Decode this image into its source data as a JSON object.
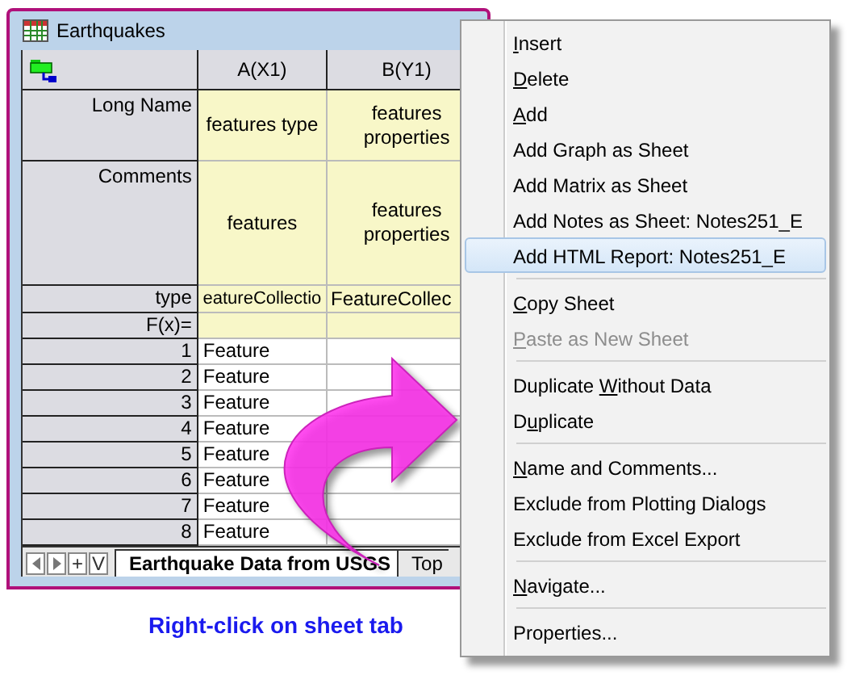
{
  "window": {
    "title": "Earthquakes"
  },
  "columns": [
    "A(X1)",
    "B(Y1)"
  ],
  "header_rows": [
    {
      "kind": "long_name",
      "label": "Long Name",
      "cells": [
        "features type",
        "features properties"
      ]
    },
    {
      "kind": "comments",
      "label": "Comments",
      "cells": [
        "features",
        "features properties"
      ]
    },
    {
      "kind": "type",
      "label": "type",
      "cells": [
        "eatureCollectio",
        "FeatureCollec"
      ]
    },
    {
      "kind": "formula",
      "label": "F(x)="
    }
  ],
  "rows": [
    {
      "index": "1",
      "cells": [
        "Feature"
      ]
    },
    {
      "index": "2",
      "cells": [
        "Feature"
      ]
    },
    {
      "index": "3",
      "cells": [
        "Feature"
      ]
    },
    {
      "index": "4",
      "cells": [
        "Feature"
      ]
    },
    {
      "index": "5",
      "cells": [
        "Feature"
      ]
    },
    {
      "index": "6",
      "cells": [
        "Feature"
      ]
    },
    {
      "index": "7",
      "cells": [
        "Feature"
      ]
    },
    {
      "index": "8",
      "cells": [
        "Feature"
      ]
    }
  ],
  "sheet_bar": {
    "buttons": [
      {
        "kind": "left"
      },
      {
        "kind": "right"
      },
      {
        "kind": "text",
        "label": "+"
      },
      {
        "kind": "text",
        "label": "V"
      }
    ],
    "tabs": [
      {
        "label": "Earthquake Data from USGS",
        "selected": true
      },
      {
        "label": "Top",
        "selected": false
      }
    ]
  },
  "caption": "Right-click on sheet tab",
  "context_menu": {
    "groups": [
      [
        {
          "access_key": "I",
          "after": "nsert",
          "selected": false,
          "disabled": false
        },
        {
          "access_key": "D",
          "after": "elete",
          "selected": false,
          "disabled": false
        },
        {
          "access_key": "A",
          "after": "dd",
          "selected": false,
          "disabled": false
        },
        {
          "before": "Add Graph as Sheet",
          "selected": false,
          "disabled": false
        },
        {
          "before": "Add Matrix as Sheet",
          "selected": false,
          "disabled": false
        },
        {
          "before": "Add Notes as Sheet: Notes251_E",
          "selected": false,
          "disabled": false
        },
        {
          "before": "Add HTML Report: Notes251_E",
          "selected": true,
          "disabled": false
        }
      ],
      [
        {
          "access_key": "C",
          "after": "opy Sheet",
          "selected": false,
          "disabled": false
        },
        {
          "access_key": "P",
          "after": "aste as New Sheet",
          "selected": false,
          "disabled": true
        }
      ],
      [
        {
          "before": "Duplicate ",
          "access_key": "W",
          "after": "ithout Data",
          "selected": false,
          "disabled": false
        },
        {
          "before": "D",
          "access_key": "u",
          "after": "plicate",
          "selected": false,
          "disabled": false
        }
      ],
      [
        {
          "access_key": "N",
          "after": "ame and Comments...",
          "selected": false,
          "disabled": false
        },
        {
          "before": "Exclude from Plotting Dialogs",
          "selected": false,
          "disabled": false
        },
        {
          "before": "Exclude from Excel Export",
          "selected": false,
          "disabled": false
        }
      ],
      [
        {
          "access_key": "N",
          "after": "avigate...",
          "selected": false,
          "disabled": false
        }
      ],
      [
        {
          "before": "Properties...",
          "selected": false,
          "disabled": false
        }
      ]
    ]
  }
}
